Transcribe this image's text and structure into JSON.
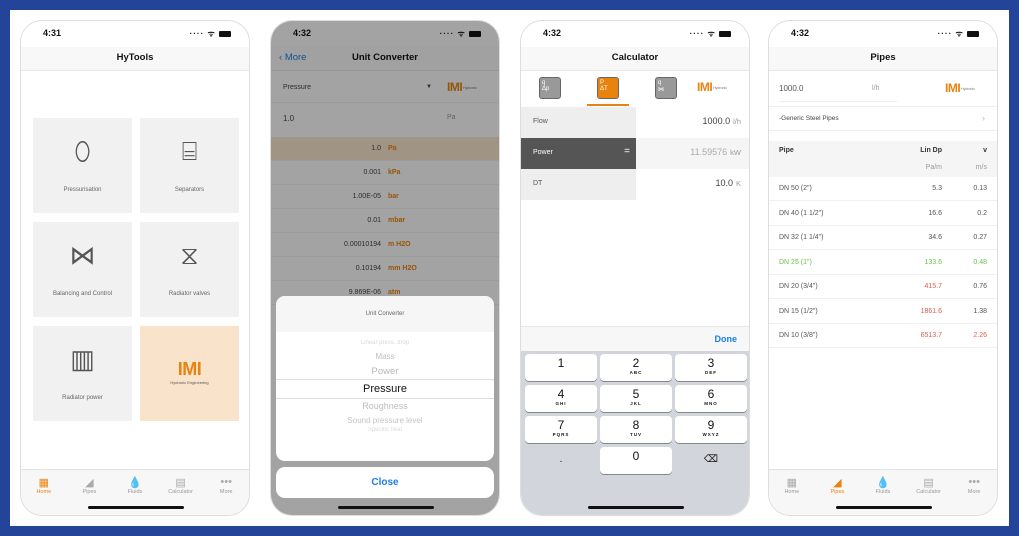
{
  "colors": {
    "accent": "#e8830f",
    "green": "#6cc04a",
    "red": "#e15b4f",
    "link": "#1a7ee6",
    "frame": "#24449a"
  },
  "home": {
    "time": "4:31",
    "title": "HyTools",
    "tiles": [
      {
        "label": "Pressurisation",
        "icon": "expansion-vessel-icon"
      },
      {
        "label": "Separators",
        "icon": "separator-icon"
      },
      {
        "label": "Balancing and Control",
        "icon": "valve-icon"
      },
      {
        "label": "Radiator valves",
        "icon": "radiator-valve-icon"
      },
      {
        "label": "Radiator power",
        "icon": "radiator-icon"
      }
    ],
    "logo": {
      "text": "IMI",
      "sub": "Hydronic Engineering"
    },
    "tabs": [
      {
        "label": "Home",
        "icon": "grid-icon",
        "active": true
      },
      {
        "label": "Pipes",
        "icon": "pipe-icon"
      },
      {
        "label": "Fluids",
        "icon": "drops-icon"
      },
      {
        "label": "Calculator",
        "icon": "calculator-icon"
      },
      {
        "label": "More",
        "icon": "more-icon"
      }
    ]
  },
  "converter": {
    "time": "4:32",
    "back": "More",
    "title": "Unit Converter",
    "quantity": "Pressure",
    "input_value": "1.0",
    "input_unit": "Pa",
    "results": [
      {
        "value": "1.0",
        "unit": "Pa"
      },
      {
        "value": "0.001",
        "unit": "kPa"
      },
      {
        "value": "1.00E-05",
        "unit": "bar"
      },
      {
        "value": "0.01",
        "unit": "mbar"
      },
      {
        "value": "0.00010194",
        "unit": "m H2O"
      },
      {
        "value": "0.10194",
        "unit": "mm H2O"
      },
      {
        "value": "9.869E-06",
        "unit": "atm"
      }
    ],
    "sheet_title": "Unit Converter",
    "picker": [
      "Linear press. drop",
      "Mass",
      "Power",
      "Pressure",
      "Roughness",
      "Sound pressure level",
      "Specific heat"
    ],
    "picker_selected": "Pressure",
    "close": "Close"
  },
  "calculator": {
    "time": "4:32",
    "title": "Calculator",
    "modes": [
      {
        "top": "q",
        "bottom": "Δp"
      },
      {
        "top": "P",
        "bottom": "ΔT",
        "active": true
      },
      {
        "top": "q",
        "bottom": "⋈"
      }
    ],
    "fields": [
      {
        "label": "Flow",
        "value": "1000.0",
        "unit": "l/h"
      },
      {
        "label": "Power",
        "value": "11.59576",
        "unit": "kW",
        "computed": true,
        "symbol": "="
      },
      {
        "label": "DT",
        "value": "10.0",
        "unit": "K"
      }
    ],
    "done": "Done",
    "keys": [
      {
        "d": "1",
        "l": ""
      },
      {
        "d": "2",
        "l": "ABC"
      },
      {
        "d": "3",
        "l": "DEF"
      },
      {
        "d": "4",
        "l": "GHI"
      },
      {
        "d": "5",
        "l": "JKL"
      },
      {
        "d": "6",
        "l": "MNO"
      },
      {
        "d": "7",
        "l": "PQRS"
      },
      {
        "d": "8",
        "l": "TUV"
      },
      {
        "d": "9",
        "l": "WXYZ"
      },
      {
        "d": ".",
        "l": ""
      },
      {
        "d": "0",
        "l": ""
      },
      {
        "d": "⌫",
        "l": ""
      }
    ]
  },
  "pipes": {
    "time": "4:32",
    "title": "Pipes",
    "flow": "1000.0",
    "flow_unit": "l/h",
    "series": "-Generic Steel Pipes",
    "headers": {
      "pipe": "Pipe",
      "dp": "Lin Dp",
      "v": "v",
      "dp_unit": "Pa/m",
      "v_unit": "m/s"
    },
    "rows": [
      {
        "pipe": "DN 50 (2\")",
        "dp": "5.3",
        "v": "0.13",
        "pc": "n",
        "dc": "n",
        "vc": "n"
      },
      {
        "pipe": "DN 40 (1 1/2\")",
        "dp": "16.6",
        "v": "0.2",
        "pc": "n",
        "dc": "n",
        "vc": "n"
      },
      {
        "pipe": "DN 32 (1 1/4\")",
        "dp": "34.6",
        "v": "0.27",
        "pc": "n",
        "dc": "n",
        "vc": "n"
      },
      {
        "pipe": "DN 25 (1\")",
        "dp": "133.6",
        "v": "0.48",
        "pc": "g",
        "dc": "g",
        "vc": "g"
      },
      {
        "pipe": "DN 20 (3/4\")",
        "dp": "415.7",
        "v": "0.76",
        "pc": "n",
        "dc": "r",
        "vc": "n"
      },
      {
        "pipe": "DN 15 (1/2\")",
        "dp": "1861.6",
        "v": "1.38",
        "pc": "n",
        "dc": "r",
        "vc": "n"
      },
      {
        "pipe": "DN 10 (3/8\")",
        "dp": "6513.7",
        "v": "2.26",
        "pc": "n",
        "dc": "r",
        "vc": "r"
      }
    ],
    "tabs": [
      {
        "label": "Home",
        "icon": "grid-icon"
      },
      {
        "label": "Pipes",
        "icon": "pipe-icon",
        "active": true
      },
      {
        "label": "Fluids",
        "icon": "drops-icon"
      },
      {
        "label": "Calculator",
        "icon": "calculator-icon"
      },
      {
        "label": "More",
        "icon": "more-icon"
      }
    ]
  }
}
